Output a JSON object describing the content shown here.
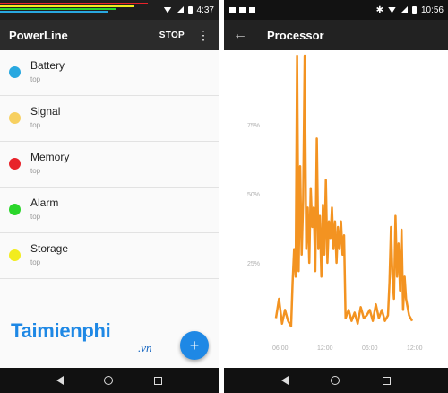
{
  "left_phone": {
    "status_time": "4:37",
    "app_title": "PowerLine",
    "stop_label": "STOP",
    "more_icon": "more-vert-icon",
    "items": [
      {
        "label": "Battery",
        "sub": "top",
        "color": "#29a8e0"
      },
      {
        "label": "Signal",
        "sub": "top",
        "color": "#f7d060"
      },
      {
        "label": "Memory",
        "sub": "top",
        "color": "#e8232a"
      },
      {
        "label": "Alarm",
        "sub": "top",
        "color": "#2bd62b"
      },
      {
        "label": "Storage",
        "sub": "top",
        "color": "#f2ec1e"
      }
    ],
    "fab_icon": "plus-icon",
    "fab_symbol": "+"
  },
  "watermark": {
    "main": "Taimienphi",
    "sub": ".vn"
  },
  "right_phone": {
    "status_time": "10:56",
    "title": "Processor",
    "back_symbol": "←"
  },
  "chart_data": {
    "type": "line",
    "title": "Processor",
    "xlabel": "",
    "ylabel": "",
    "y_tick_labels": [
      "75%",
      "50%",
      "25%"
    ],
    "x_tick_labels": [
      "06:00",
      "12:00",
      "06:00",
      "12:00"
    ],
    "ylim": [
      0,
      100
    ],
    "grid": false,
    "series": [
      {
        "color": "#f39321",
        "x": [
          0,
          1,
          2,
          3,
          4,
          5,
          5.5,
          6,
          6.5,
          7,
          7.5,
          8,
          8.5,
          9,
          9.5,
          10,
          10.5,
          11,
          11.5,
          12,
          12.5,
          13,
          13.5,
          14,
          14.5,
          15,
          15.5,
          16,
          16.5,
          17,
          17.5,
          18,
          18.5,
          19,
          19.5,
          20,
          20.5,
          21,
          21.5,
          22,
          22.5,
          23,
          24,
          25,
          26,
          27,
          28,
          29,
          30,
          31,
          32,
          33,
          34,
          35,
          36,
          37,
          37.5,
          38,
          38.5,
          39,
          39.5,
          40,
          40.5,
          41,
          41.5,
          42,
          42.5,
          43,
          44,
          45
        ],
        "values": [
          5,
          12,
          3,
          8,
          4,
          2,
          18,
          30,
          20,
          100,
          22,
          60,
          28,
          48,
          100,
          30,
          45,
          25,
          52,
          38,
          45,
          22,
          70,
          30,
          42,
          20,
          46,
          28,
          55,
          25,
          40,
          34,
          45,
          30,
          40,
          25,
          38,
          30,
          40,
          28,
          35,
          5,
          8,
          4,
          7,
          3,
          9,
          5,
          6,
          8,
          4,
          10,
          5,
          8,
          4,
          6,
          18,
          38,
          20,
          12,
          42,
          20,
          32,
          15,
          37,
          8,
          20,
          12,
          6,
          4
        ]
      }
    ]
  }
}
